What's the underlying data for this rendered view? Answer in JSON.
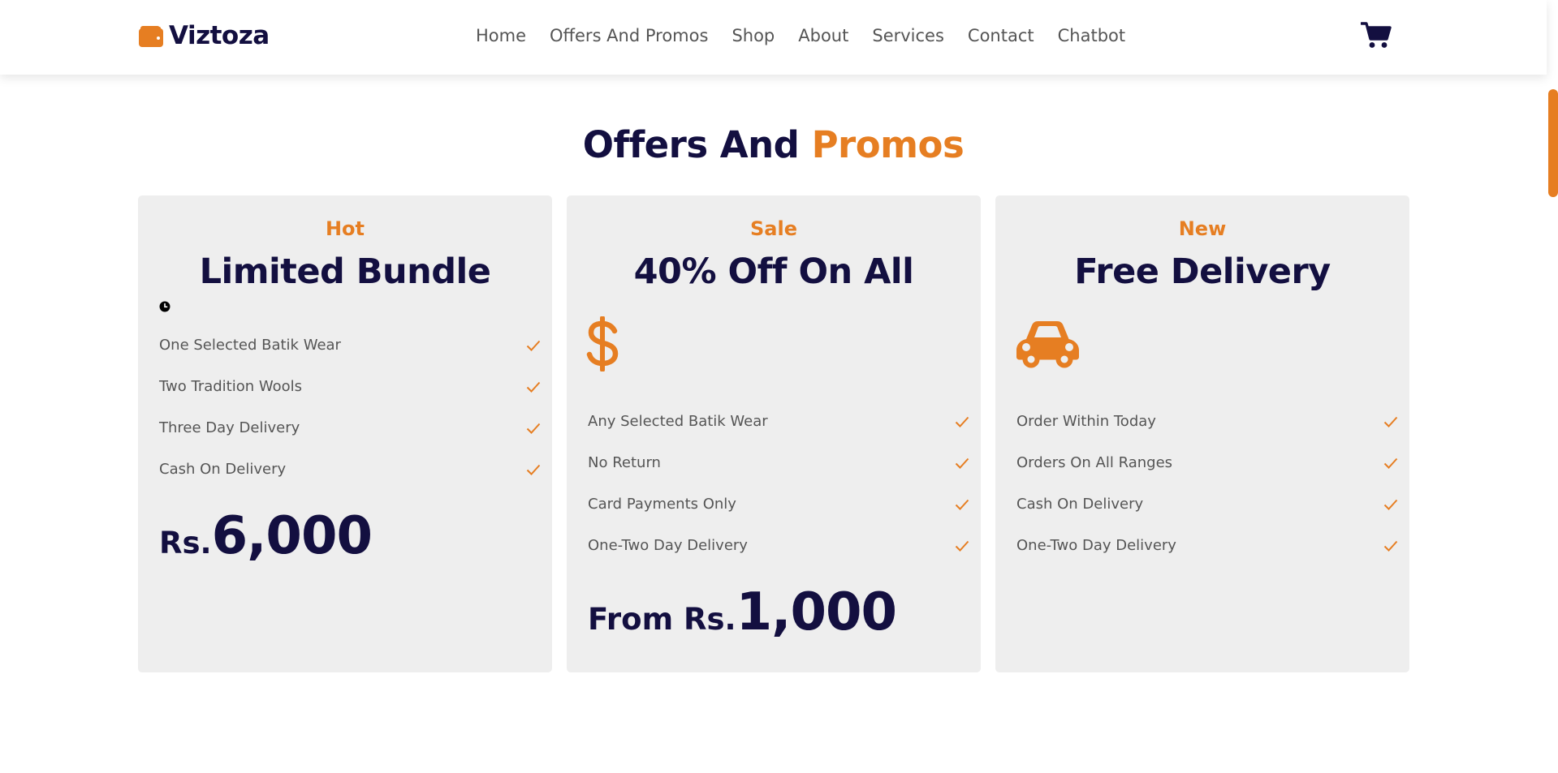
{
  "colors": {
    "brand": "#e67e22",
    "navy": "#130f40",
    "card_bg": "#eeeeee",
    "text_muted": "#555555"
  },
  "header": {
    "logo_icon": "wallet-icon",
    "logo_text": "Viztoza",
    "nav": [
      "Home",
      "Offers And Promos",
      "Shop",
      "About",
      "Services",
      "Contact",
      "Chatbot"
    ],
    "cart_icon": "shopping-cart-icon"
  },
  "section": {
    "title_main": "Offers And ",
    "title_accent": "Promos"
  },
  "cards": [
    {
      "tag": "Hot",
      "heading": "Limited Bundle",
      "icon": "clock-icon",
      "features": [
        "One Selected Batik Wear",
        "Two Tradition Wools",
        "Three Day Delivery",
        "Cash On Delivery"
      ],
      "price_prefix": "Rs.",
      "price_amount": "6,000"
    },
    {
      "tag": "Sale",
      "heading": "40% Off On All",
      "icon": "dollar-icon",
      "features": [
        "Any Selected Batik Wear",
        "No Return",
        "Card Payments Only",
        "One-Two Day Delivery"
      ],
      "price_prefix": "From Rs.",
      "price_amount": "1,000"
    },
    {
      "tag": "New",
      "heading": "Free Delivery",
      "icon": "car-icon",
      "features": [
        "Order Within Today",
        "Orders On All Ranges",
        "Cash On Delivery",
        "One-Two Day Delivery"
      ]
    }
  ],
  "check_icon": "check-icon"
}
